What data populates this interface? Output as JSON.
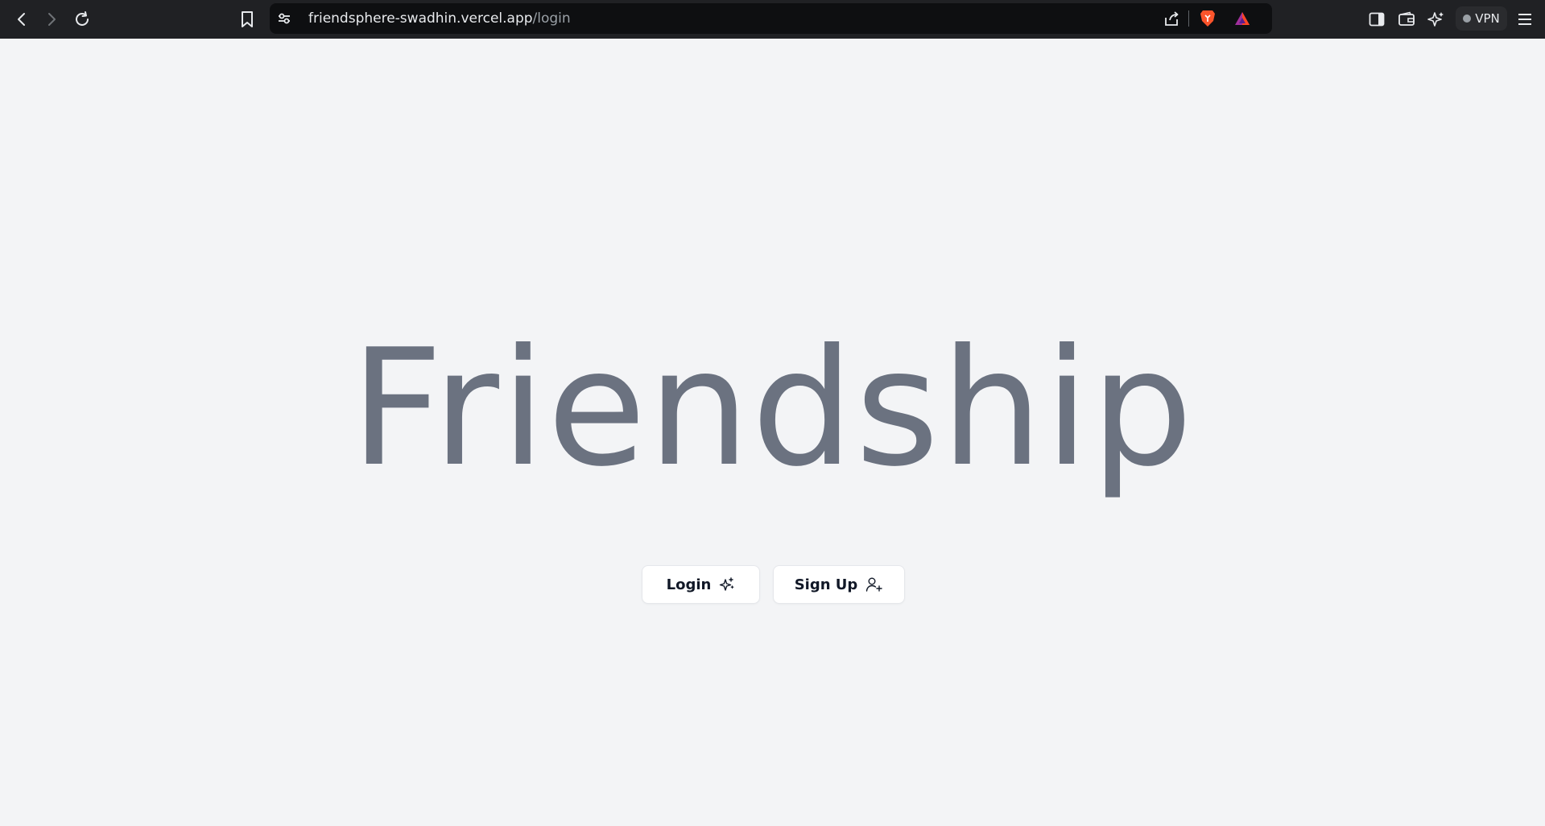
{
  "browser": {
    "url_host": "friendsphere-swadhin.vercel.app",
    "url_path": "/login",
    "vpn_label": "VPN",
    "icons": [
      "back-icon",
      "forward-icon",
      "reload-icon",
      "bookmark-icon",
      "site-settings-icon",
      "share-icon",
      "brave-shield-icon",
      "brave-rewards-icon",
      "sidebar-icon",
      "wallet-icon",
      "leo-ai-icon",
      "menu-icon"
    ]
  },
  "hero": {
    "title": "Friendship"
  },
  "actions": {
    "login_label": "Login",
    "login_icon": "sparkles-icon",
    "signup_label": "Sign Up",
    "signup_icon": "user-plus-icon"
  }
}
